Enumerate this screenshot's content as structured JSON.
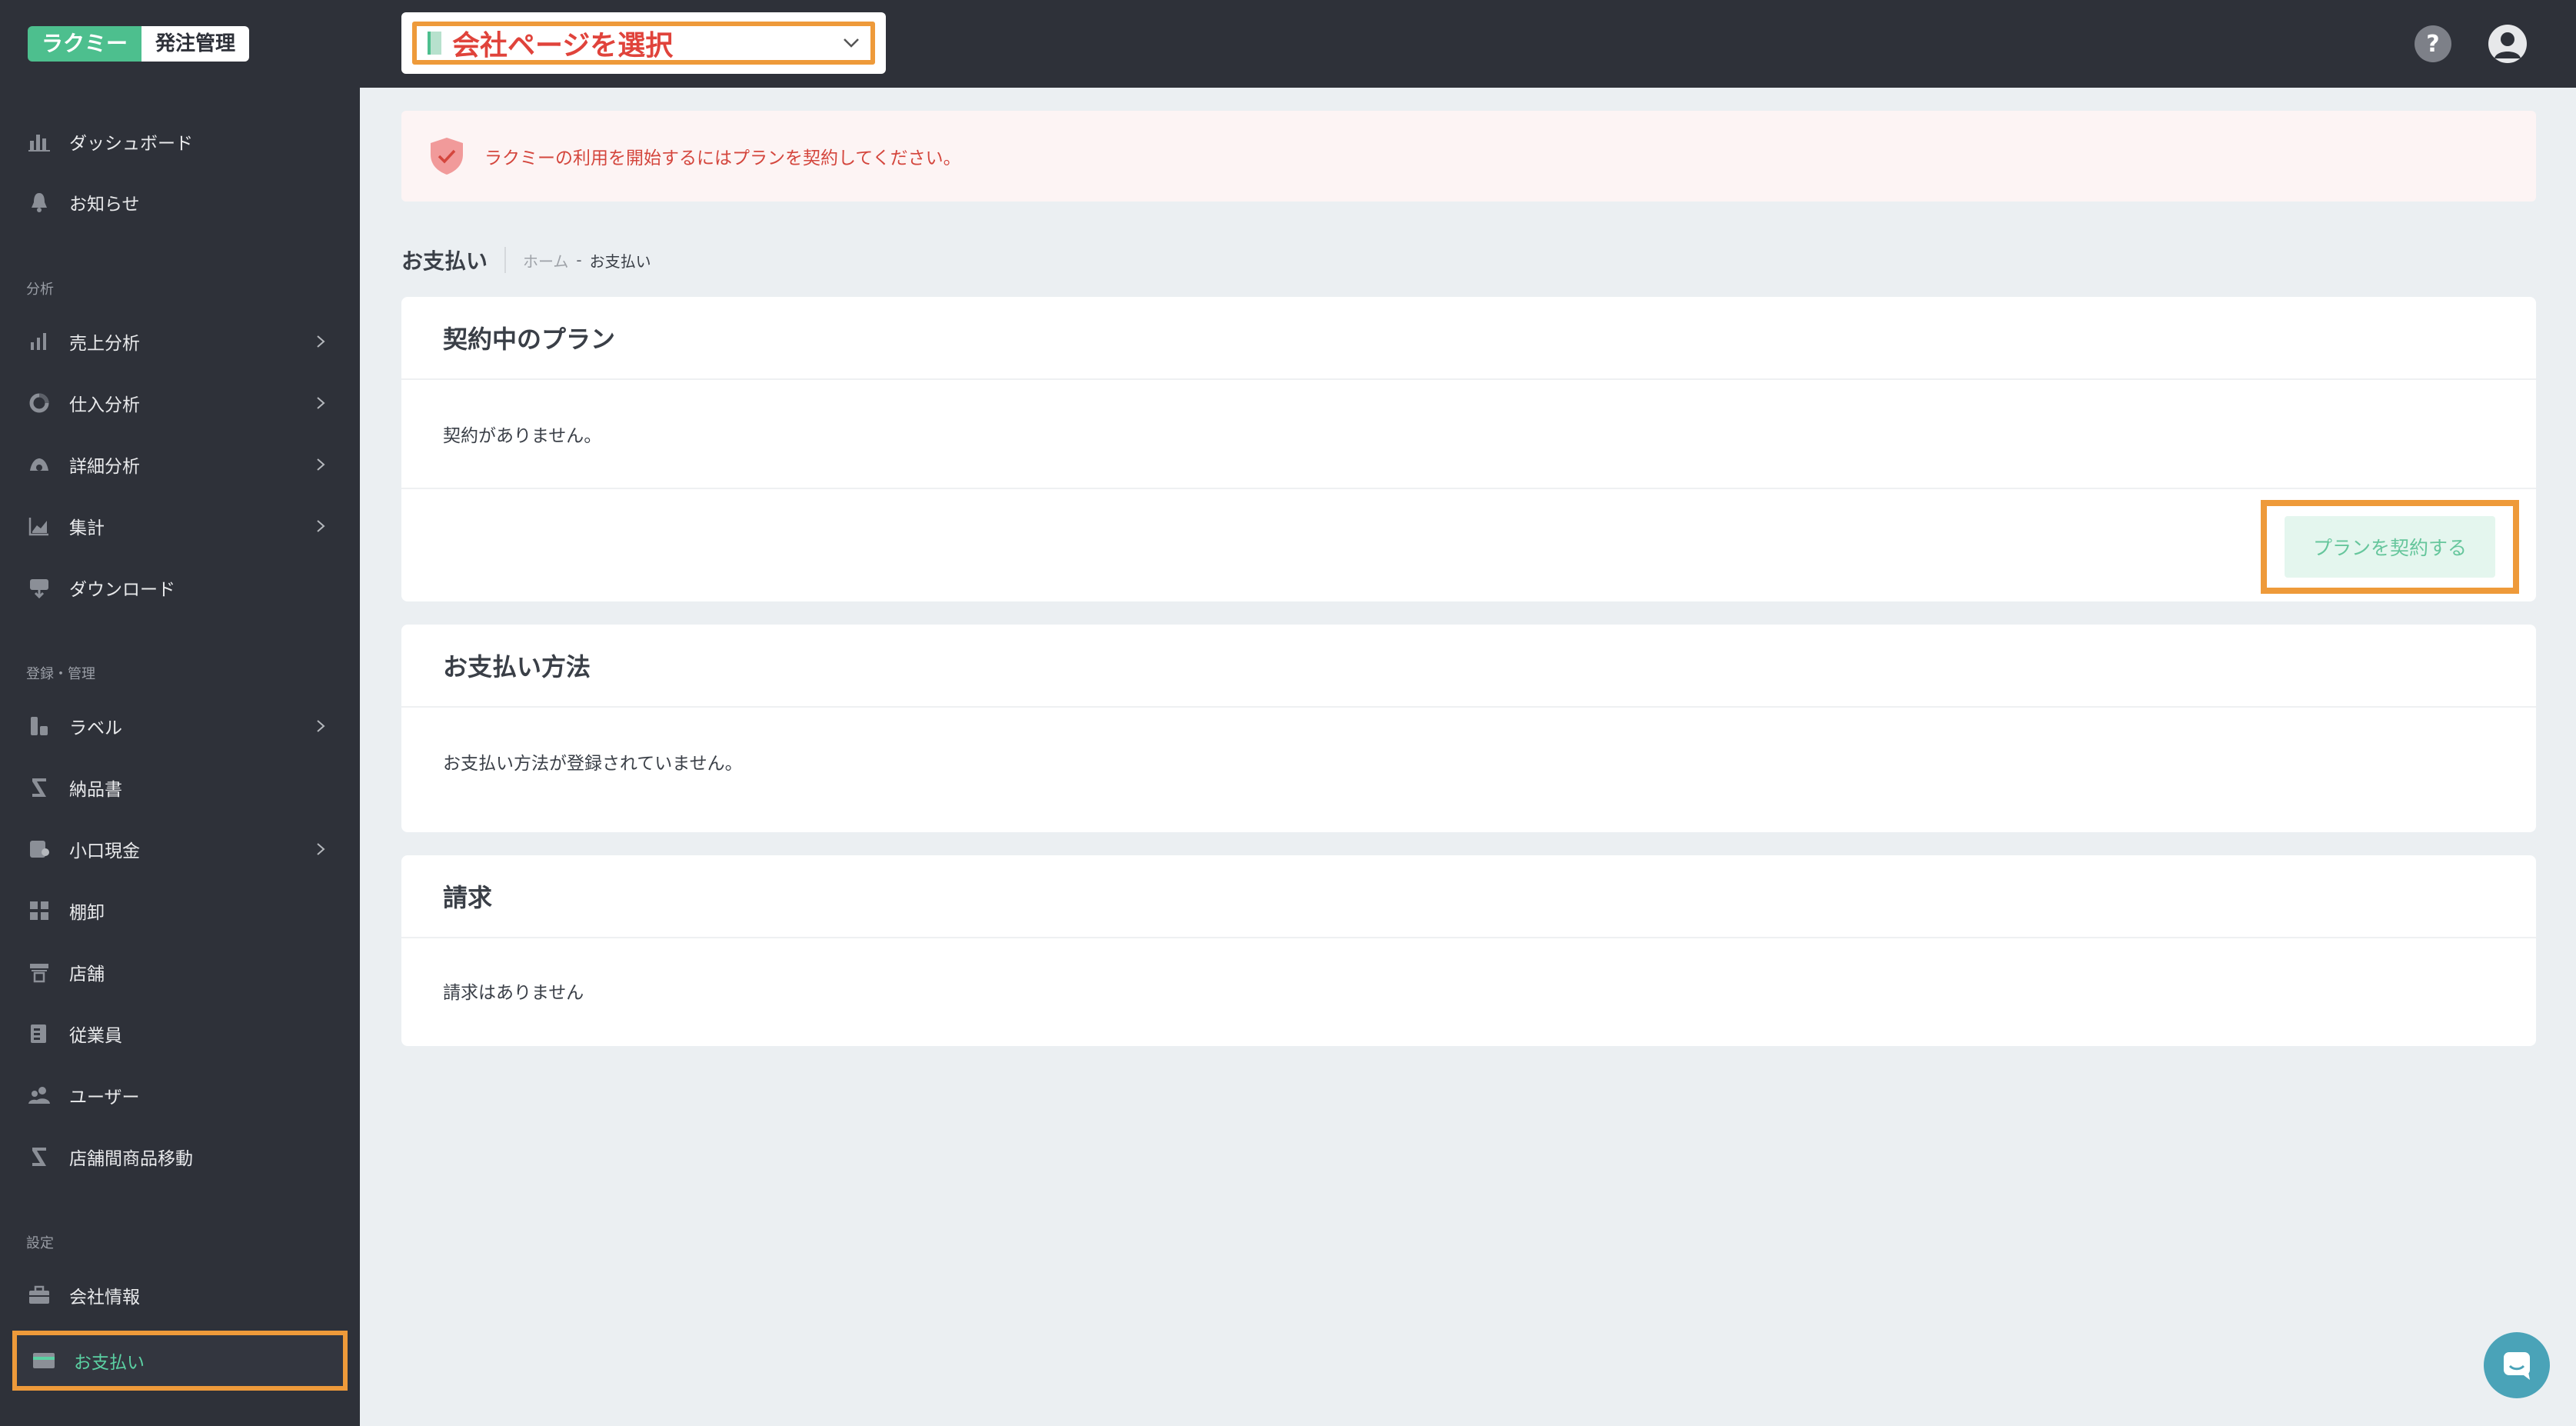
{
  "header": {
    "logo_primary": "ラクミー",
    "logo_secondary": "発注管理",
    "company_select": {
      "value": "会社ページを選択"
    },
    "help_label": "?"
  },
  "sidebar": {
    "items_top": [
      {
        "label": "ダッシュボード",
        "icon": "dashboard-icon"
      },
      {
        "label": "お知らせ",
        "icon": "bell-icon"
      }
    ],
    "section_analysis": "分析",
    "items_analysis": [
      {
        "label": "売上分析",
        "icon": "bar-chart-icon",
        "has_children": true
      },
      {
        "label": "仕入分析",
        "icon": "pie-chart-icon",
        "has_children": true
      },
      {
        "label": "詳細分析",
        "icon": "detail-chart-icon",
        "has_children": true
      },
      {
        "label": "集計",
        "icon": "line-chart-icon",
        "has_children": true
      },
      {
        "label": "ダウンロード",
        "icon": "download-icon",
        "has_children": false
      }
    ],
    "section_register": "登録・管理",
    "items_register": [
      {
        "label": "ラベル",
        "icon": "label-icon",
        "has_children": true
      },
      {
        "label": "納品書",
        "icon": "delivery-slip-icon",
        "has_children": false
      },
      {
        "label": "小口現金",
        "icon": "petty-cash-icon",
        "has_children": true
      },
      {
        "label": "棚卸",
        "icon": "inventory-icon",
        "has_children": false
      },
      {
        "label": "店舗",
        "icon": "store-icon",
        "has_children": false
      },
      {
        "label": "従業員",
        "icon": "employee-icon",
        "has_children": false
      },
      {
        "label": "ユーザー",
        "icon": "users-icon",
        "has_children": false
      },
      {
        "label": "店舗間商品移動",
        "icon": "transfer-icon",
        "has_children": false
      }
    ],
    "section_settings": "設定",
    "items_settings": [
      {
        "label": "会社情報",
        "icon": "briefcase-icon",
        "has_children": false
      },
      {
        "label": "お支払い",
        "icon": "credit-card-icon",
        "has_children": false,
        "active": true
      }
    ]
  },
  "alert": {
    "text": "ラクミーの利用を開始するにはプランを契約してください。"
  },
  "page": {
    "title": "お支払い",
    "breadcrumb_home": "ホーム",
    "breadcrumb_sep": "-",
    "breadcrumb_current": "お支払い"
  },
  "cards": {
    "plan": {
      "title": "契約中のプラン",
      "body": "契約がありません。",
      "button": "プランを契約する"
    },
    "payment_method": {
      "title": "お支払い方法",
      "body": "お支払い方法が登録されていません。"
    },
    "billing": {
      "title": "請求",
      "body": "請求はありません"
    }
  },
  "colors": {
    "sidebar_bg": "#2e3139",
    "main_bg": "#ebeff2",
    "accent_green": "#4dbf8e",
    "alert_red": "#d4463d",
    "highlight_orange": "#ee9a3a"
  }
}
